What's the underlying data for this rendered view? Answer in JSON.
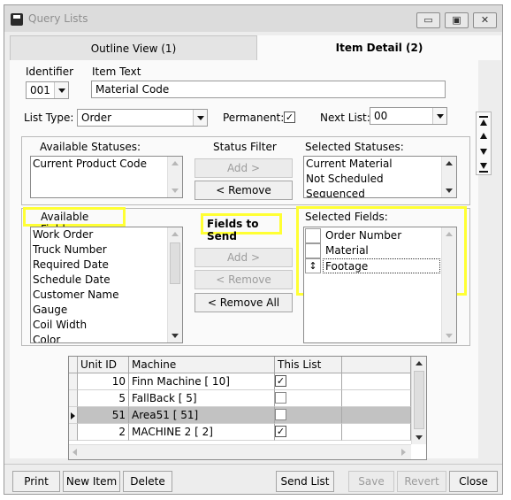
{
  "window": {
    "title": "Query Lists",
    "controls": {
      "minimize": "▭",
      "restore": "▣",
      "close": "✕"
    }
  },
  "tabs": [
    {
      "label": "Outline View (1)"
    },
    {
      "label": "Item Detail (2)"
    }
  ],
  "fields": {
    "identifier_label": "Identifier",
    "identifier_value": "001",
    "item_text_label": "Item Text",
    "item_text_value": "Material Code",
    "list_type_label": "List Type:",
    "list_type_value": "Order",
    "permanent_label": "Permanent:",
    "permanent_checked": true,
    "next_list_label": "Next List:",
    "next_list_value": "00"
  },
  "statuses": {
    "available_label": "Available Statuses:",
    "available": [
      "Current Product Code"
    ],
    "filter_label": "Status Filter",
    "add_label": "Add >",
    "remove_label": "< Remove",
    "selected_label": "Selected Statuses:",
    "selected": [
      "Current Material",
      "Not Scheduled",
      "Sequenced"
    ]
  },
  "fields_section": {
    "available_label": "Available Fields:",
    "available": [
      "Work Order",
      "Truck Number",
      "Required Date",
      "Schedule Date",
      "Customer Name",
      "Gauge",
      "Coil Width",
      "Color"
    ],
    "send_label": "Fields to Send",
    "add_label": "Add >",
    "remove_label": "< Remove",
    "remove_all_label": "< Remove All",
    "selected_label": "Selected Fields:",
    "selected": [
      "Order Number",
      "Material",
      "Footage"
    ]
  },
  "grid": {
    "columns": [
      "Unit ID",
      "Machine",
      "This List"
    ],
    "rows": [
      {
        "unit_id": "10",
        "machine": "Finn Machine   [ 10]",
        "checked": true
      },
      {
        "unit_id": "5",
        "machine": "FallBack   [ 5]",
        "checked": false
      },
      {
        "unit_id": "51",
        "machine": "Area51   [ 51]",
        "checked": false
      },
      {
        "unit_id": "2",
        "machine": "MACHINE 2   [ 2]",
        "checked": true
      }
    ]
  },
  "buttons": {
    "print": "Print",
    "new_item": "New Item",
    "delete": "Delete",
    "send_list": "Send List",
    "save": "Save",
    "revert": "Revert",
    "close": "Close"
  },
  "colors": {
    "highlight": "#ffff33",
    "selected_row": "#c2c2c2"
  }
}
